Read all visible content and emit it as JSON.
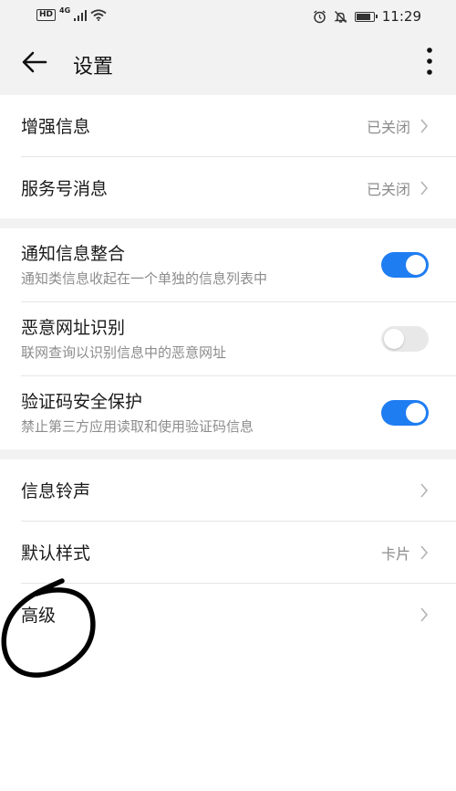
{
  "status_bar": {
    "network_hd": "HD",
    "network_gen": "4G",
    "signal_icon": "signal-bars-icon",
    "wifi_icon": "wifi-icon",
    "alarm_icon": "alarm-icon",
    "mute_icon": "bell-off-icon",
    "battery_level": 0.85,
    "time": "11:29"
  },
  "toolbar": {
    "back_icon": "arrow-left-icon",
    "title": "设置",
    "more_icon": "more-vertical-icon"
  },
  "groups": [
    {
      "items": [
        {
          "label": "增强信息",
          "value": "已关闭"
        },
        {
          "label": "服务号消息",
          "value": "已关闭"
        }
      ]
    },
    {
      "items": [
        {
          "label": "通知信息整合",
          "sub": "通知类信息收起在一个单独的信息列表中",
          "on": true
        },
        {
          "label": "恶意网址识别",
          "sub": "联网查询以识别信息中的恶意网址",
          "on": false
        },
        {
          "label": "验证码安全保护",
          "sub": "禁止第三方应用读取和使用验证码信息",
          "on": true
        }
      ]
    },
    {
      "items": [
        {
          "label": "信息铃声",
          "value": ""
        },
        {
          "label": "默认样式",
          "value": "卡片"
        },
        {
          "label": "高级",
          "value": ""
        }
      ]
    }
  ],
  "colors": {
    "accent": "#1f7df2",
    "background_gray": "#f2f2f2",
    "secondary_text": "#8c8c8c",
    "annotation_ink": "#000000"
  }
}
